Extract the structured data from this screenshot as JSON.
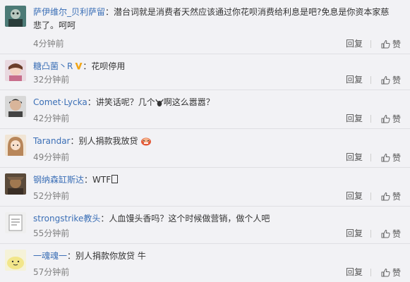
{
  "actions": {
    "reply_label": "回复",
    "like_label": "赞"
  },
  "comments": [
    {
      "user": "萨伊维尔_贝利萨留",
      "colon": "：",
      "text": "潜台词就是消费者天然应该通过你花呗消费给利息是吧?免息是你资本家慈悲了。呵呵",
      "time": "4分钟前"
    },
    {
      "user": "糖凸菌丶R",
      "colon": "：",
      "text": "花呗停用",
      "time": "32分钟前"
    },
    {
      "user": "Comet·Lycka",
      "colon": "：",
      "text_before": "讲笑话呢？几个",
      "text_after": "啊这么嚣嚣？",
      "time": "42分钟前"
    },
    {
      "user": "Tarandar",
      "colon": "：",
      "text": "别人捐款我放贷",
      "time": "49分钟前"
    },
    {
      "user": "钢纳森缸斯达",
      "colon": "：",
      "text": "WTF",
      "time": "52分钟前"
    },
    {
      "user": "strongstrike教头",
      "colon": "：",
      "text": "人血馒头香吗？这个时候做营销，做个人吧",
      "time": "55分钟前"
    },
    {
      "user": "一魂魂一",
      "colon": "：",
      "text": "别人捐款你放贷 牛",
      "time": "57分钟前"
    }
  ],
  "icons": {
    "vip": "vip-v-badge-icon",
    "like": "thumbs-up-icon",
    "emoji_ox": "ox-emoji-icon",
    "emoji_cry": "crying-face-emoji-icon",
    "unknown_glyph": "missing-glyph-box"
  },
  "colors": {
    "username": "#3b6fb6",
    "vip": "#f0a619",
    "time": "#808080",
    "background": "#f2f2f5"
  }
}
